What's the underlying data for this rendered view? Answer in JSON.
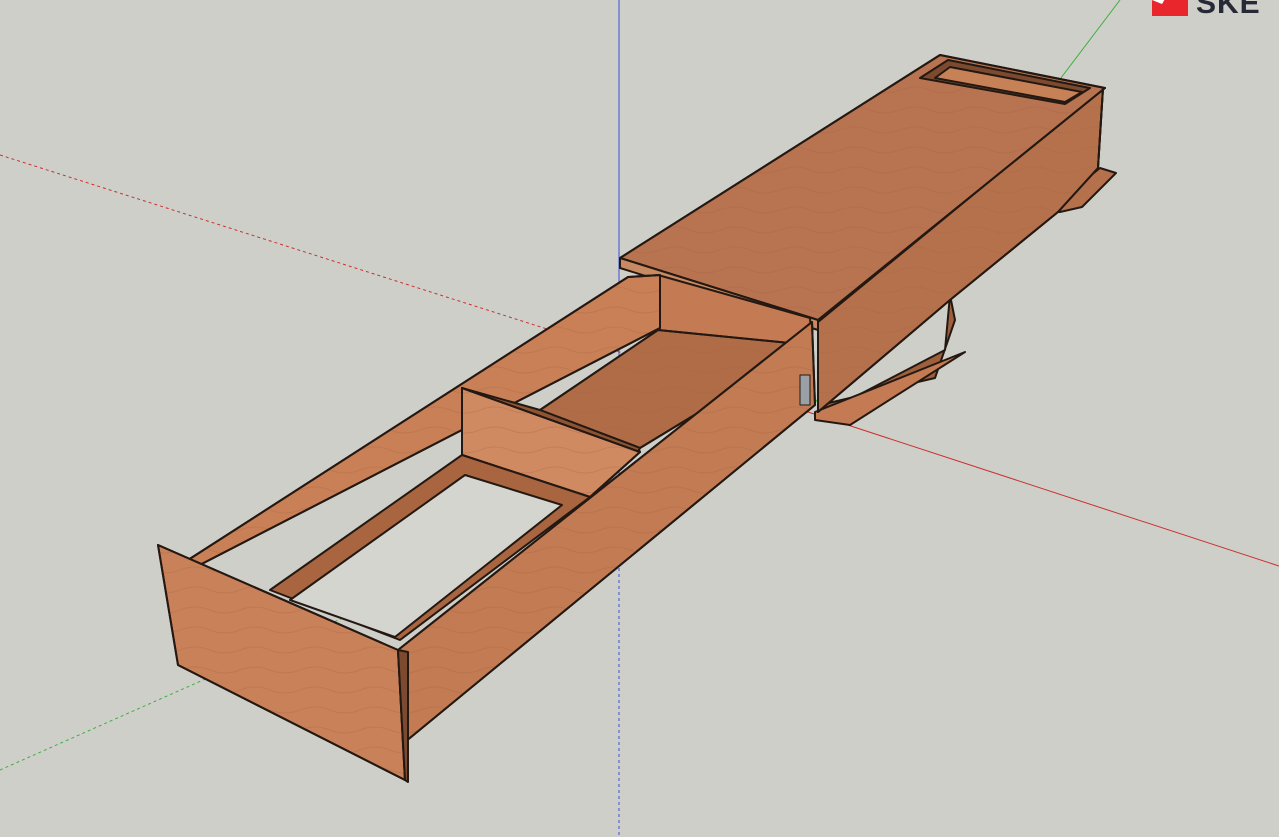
{
  "app": {
    "brand_text": "SKE",
    "brand_logo_icon": "sketchup-logo-icon"
  },
  "colors": {
    "background": "#cfcfca",
    "axis_red": "#c9302f",
    "axis_green": "#3fae3f",
    "axis_blue": "#3d4fd6",
    "wood_light": "#d4875f",
    "wood_mid": "#b5714c",
    "wood_dark": "#8e5434",
    "edge": "#241912",
    "brand_red": "#e8262b",
    "brand_dark": "#262a37"
  },
  "model": {
    "object": "drawer-box-with-lid",
    "material": "plywood"
  }
}
